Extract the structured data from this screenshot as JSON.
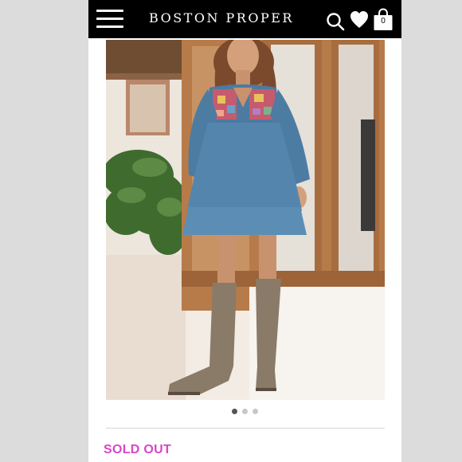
{
  "header": {
    "brand": "BOSTON PROPER",
    "bag_count": "0",
    "icons": [
      "menu-icon",
      "search-icon",
      "heart-icon",
      "shopping-bag-icon"
    ]
  },
  "product_image": {
    "description_icon": "product-photo"
  },
  "carousel": {
    "dot_count": 3,
    "active_index": 0
  },
  "status": {
    "label": "SOLD OUT",
    "color": "#d946c7"
  },
  "colors": {
    "header_bg": "#000000",
    "page_bg": "#ffffff",
    "outer_bg": "#dcdcdc"
  }
}
